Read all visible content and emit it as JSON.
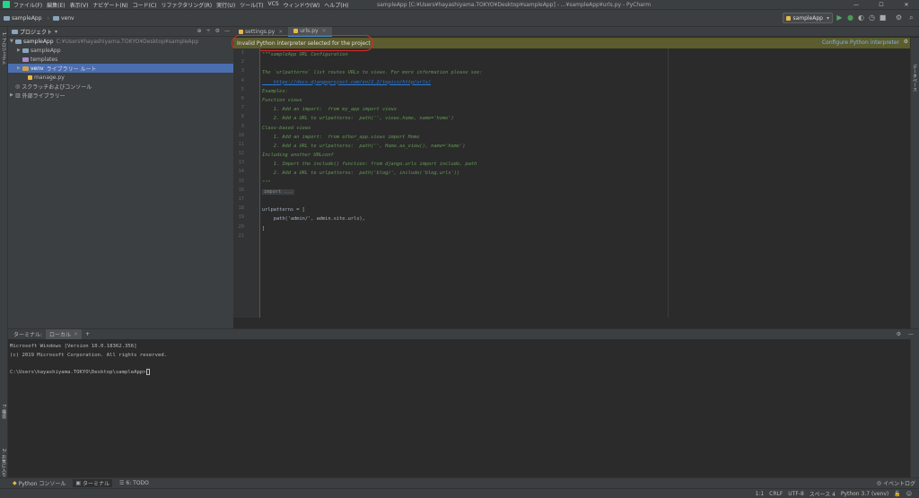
{
  "titlebar": {
    "menu": [
      "ファイル(F)",
      "編集(E)",
      "表示(V)",
      "ナビゲート(N)",
      "コード(C)",
      "リファクタリング(R)",
      "実行(U)",
      "ツール(T)",
      "VCS",
      "ウィンドウ(W)",
      "ヘルプ(H)"
    ],
    "window_title": "sampleApp [C:¥Users¥hayashiyama.TOKYO¥Desktop¥sampleApp] - ...¥sampleApp¥urls.py - PyCharm",
    "minimize": "—",
    "maximize": "☐",
    "close": "✕"
  },
  "navbar": {
    "crumbs": [
      "sampleApp",
      "venv"
    ],
    "run_config": "sampleApp",
    "colors": {
      "run": "#59a869",
      "debug": "#499c54"
    }
  },
  "left_strip": {
    "project": "1: プロジェクト",
    "structure": "7: 構造",
    "favorites": "2: お気に入り"
  },
  "right_strip": {
    "database": "データベース"
  },
  "project": {
    "title": "プロジェクト",
    "tree": [
      {
        "label": "sampleApp",
        "path": "C:¥Users¥hayashiyama.TOKYO¥Desktop¥sampleApp"
      },
      {
        "label": "sampleApp"
      },
      {
        "label": "templates"
      },
      {
        "label": "venv",
        "extra": "ライブラリー ルート"
      },
      {
        "label": "manage.py"
      },
      {
        "label": "スクラッチおよびコンソール"
      },
      {
        "label": "外部ライブラリー"
      }
    ]
  },
  "editor": {
    "tabs": [
      "settings.py",
      "urls.py"
    ],
    "banner": "Invalid Python interpreter selected for the project",
    "banner_action": "Configure Python interpreter",
    "lines": [
      "1",
      "2",
      "3",
      "4",
      "5",
      "6",
      "7",
      "8",
      "9",
      "10",
      "11",
      "12",
      "13",
      "14",
      "15",
      "16",
      "17",
      "18",
      "19",
      "20",
      "21"
    ],
    "code": [
      "\"\"\"sampleApp URL Configuration",
      "",
      "The `urlpatterns` list routes URLs to views. For more information please see:",
      "    https://docs.djangoproject.com/en/2.2/topics/http/urls/",
      "Examples:",
      "Function views",
      "    1. Add an import:  from my_app import views",
      "    2. Add a URL to urlpatterns:  path('', views.home, name='home')",
      "Class-based views",
      "    1. Add an import:  from other_app.views import Home",
      "    2. Add a URL to urlpatterns:  path('', Home.as_view(), name='home')",
      "Including another URLconf",
      "    1. Import the include() function: from django.urls import include, path",
      "    2. Add a URL to urlpatterns:  path('blog/', include('blog.urls'))",
      "\"\"\"",
      "import ...",
      "",
      "urlpatterns = [",
      "    path('admin/', admin.site.urls),",
      "]",
      ""
    ]
  },
  "terminal": {
    "label": "ターミナル:",
    "tab": "ローカル",
    "add": "+",
    "lines": [
      "Microsoft Windows [Version 10.0.18362.356]",
      "(c) 2019 Microsoft Corporation. All rights reserved.",
      "",
      "C:\\Users\\hayashiyama.TOKYO\\Desktop\\sampleApp>"
    ]
  },
  "bottom_tabs": [
    "Python コンソール",
    "ターミナル",
    "6: TODO"
  ],
  "status": {
    "position": "1:1",
    "line_sep": "CRLF",
    "encoding": "UTF-8",
    "indent": "スペース 4",
    "interpreter": "Python 3.7 (venv)",
    "event_log": "イベントログ"
  }
}
